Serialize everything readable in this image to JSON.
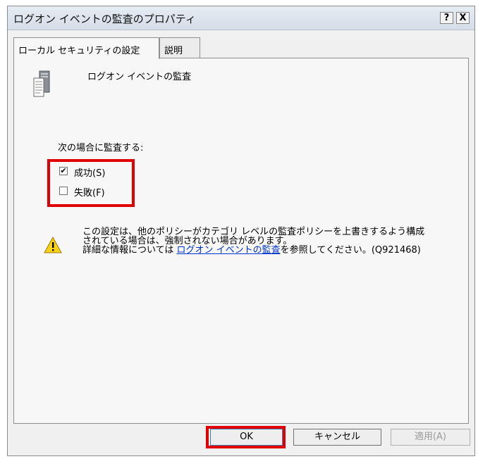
{
  "window": {
    "title": "ログオン イベントの監査のプロパティ",
    "help_label": "?",
    "close_label": "X"
  },
  "tabs": [
    {
      "label": "ローカル セキュリティの設定",
      "active": true
    },
    {
      "label": "説明",
      "active": false
    }
  ],
  "policy": {
    "name": "ログオン イベントの監査",
    "icon": "server-policy-icon"
  },
  "audit": {
    "label": "次の場合に監査する:",
    "options": [
      {
        "label": "成功(S)",
        "checked": true
      },
      {
        "label": "失敗(F)",
        "checked": false
      }
    ]
  },
  "warning": {
    "icon": "warning-icon",
    "line1": "この設定は、他のポリシーがカテゴリ レベルの監査ポリシーを上書きするよう構成",
    "line2": "されている場合は、強制されない場合があります。",
    "line3_prefix": "詳細な情報については ",
    "link_text": "ログオン イベントの監査",
    "line3_suffix": "を参照してください。(Q921468)"
  },
  "buttons": {
    "ok": "OK",
    "cancel": "キャンセル",
    "apply": "適用(A)"
  },
  "colors": {
    "highlight": "#e00000",
    "link": "#0033cc"
  }
}
